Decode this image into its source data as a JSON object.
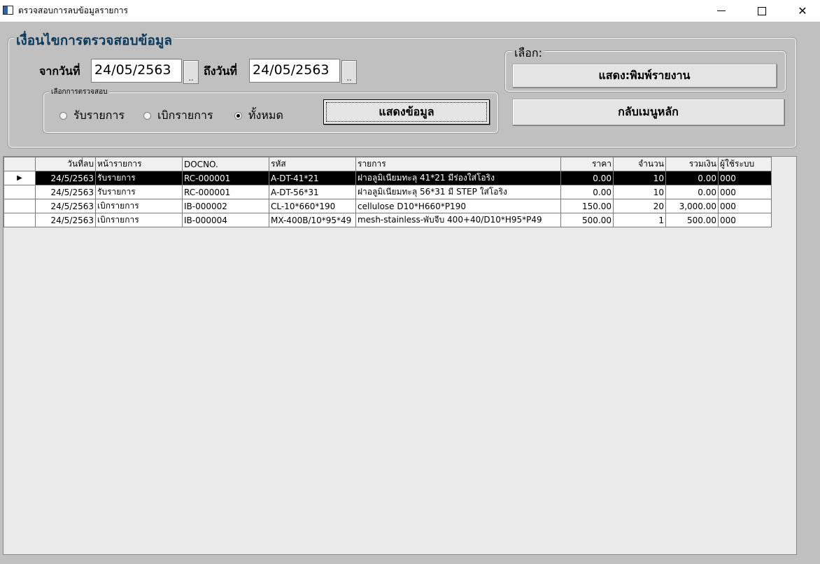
{
  "window": {
    "title": "ตรวจสอบการลบข้อมูลรายการ",
    "min_icon": "minimize-icon",
    "max_icon": "maximize-icon",
    "close_symbol": "✕"
  },
  "condition": {
    "legend": "เงื่อนไขการตรวจสอบข้อมูล",
    "from_label": "จากวันที่",
    "from_value": "24/05/2563",
    "to_label": "ถึงวันที่",
    "to_value": "24/05/2563",
    "picker_label": "..",
    "check_legend": "เลือกการตรวจสอบ",
    "radios": [
      {
        "label": "รับรายการ",
        "selected": false
      },
      {
        "label": "เบิกรายการ",
        "selected": false
      },
      {
        "label": "ทั้งหมด",
        "selected": true
      }
    ],
    "show_button": "แสดงข้อมูล"
  },
  "select": {
    "legend": "เลือก:",
    "print_button": "แสดง:พิมพ์รายงาน",
    "menu_button": "กลับเมนูหลัก"
  },
  "grid": {
    "columns": [
      "วันที่ลบ",
      "หน้ารายการ",
      "DOCNO.",
      "รหัส",
      "รายการ",
      "ราคา",
      "จำนวน",
      "รวมเงิน",
      "ผู้ใช้ระบบ"
    ],
    "rows": [
      {
        "date": "24/5/2563",
        "page": "รับรายการ",
        "docno": "RC-000001",
        "code": "A-DT-41*21",
        "item": "ฝาอลูมิเนียมทะลุ 41*21 มีร่องใส่โอริง",
        "price": "0.00",
        "qty": "10",
        "total": "0.00",
        "user": "000",
        "selected": true
      },
      {
        "date": "24/5/2563",
        "page": "รับรายการ",
        "docno": "RC-000001",
        "code": "A-DT-56*31",
        "item": "ฝาอลูมิเนียมทะลุ 56*31 มี STEP ใส่โอริง",
        "price": "0.00",
        "qty": "10",
        "total": "0.00",
        "user": "000",
        "selected": false
      },
      {
        "date": "24/5/2563",
        "page": "เบิกรายการ",
        "docno": "IB-000002",
        "code": "CL-10*660*190",
        "item": "cellulose D10*H660*P190",
        "price": "150.00",
        "qty": "20",
        "total": "3,000.00",
        "user": "000",
        "selected": false
      },
      {
        "date": "24/5/2563",
        "page": "เบิกรายการ",
        "docno": "IB-000004",
        "code": "MX-400B/10*95*49",
        "item": "mesh-stainless-พับจีบ 400+40/D10*H95*P49",
        "price": "500.00",
        "qty": "1",
        "total": "500.00",
        "user": "000",
        "selected": false
      }
    ]
  }
}
